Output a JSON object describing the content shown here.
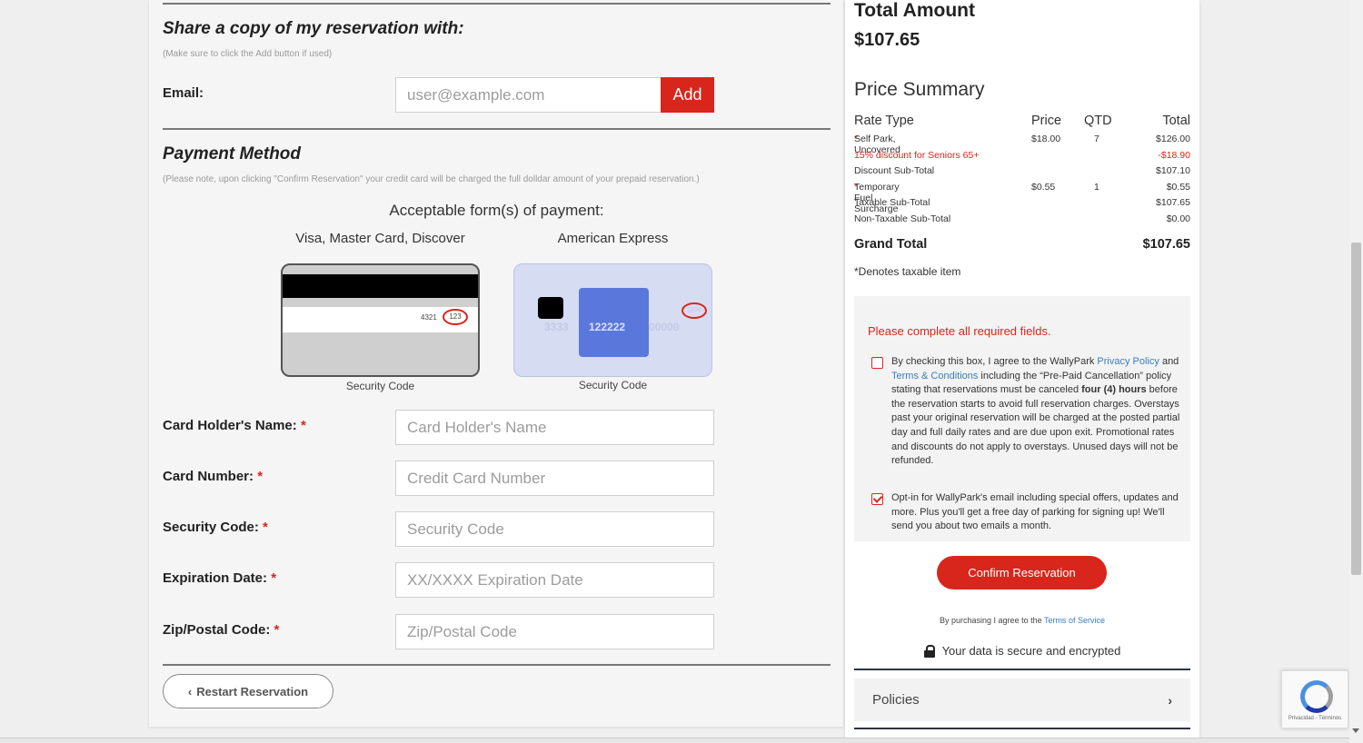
{
  "share": {
    "title": "Share a copy of my reservation with:",
    "note": "(Make sure to click the Add button if used)",
    "email_label": "Email:",
    "email_placeholder": "user@example.com",
    "add_label": "Add"
  },
  "payment": {
    "title": "Payment Method",
    "note": "(Please note, upon clicking \"Confirm Reservation\" your credit card will be charged the full dolldar amount of your prepaid reservation.)",
    "acceptable": "Acceptable form(s) of payment:",
    "card_types_1": "Visa, Master Card, Discover",
    "card_types_2": "American Express",
    "card1_number": "4321",
    "card1_cvv": "123",
    "card2_n1": "3333",
    "card2_n2": "122222",
    "card2_n3": "00000",
    "card2_cvv": "1234",
    "security_code_caption_1": "Security Code",
    "security_code_caption_2": "Security Code",
    "fields": [
      {
        "label": "Card Holder's Name:",
        "placeholder": "Card Holder's Name"
      },
      {
        "label": "Card Number:",
        "placeholder": "Credit Card Number"
      },
      {
        "label": "Security Code:",
        "placeholder": "Security Code"
      },
      {
        "label": "Expiration Date:",
        "placeholder": "XX/XXXX Expiration Date"
      },
      {
        "label": "Zip/Postal Code:",
        "placeholder": "Zip/Postal Code"
      }
    ],
    "required_marker": "*",
    "restart_label": "Restart Reservation",
    "restart_icon": "chevron-left-icon"
  },
  "summary": {
    "total_label": "Total Amount",
    "total_value": "$107.65",
    "title": "Price Summary",
    "headers": {
      "rate": "Rate Type",
      "price": "Price",
      "qty": "QTD",
      "total": "Total"
    },
    "rows": [
      {
        "rate": "Self Park, Uncovered",
        "price": "$18.00",
        "qty": "7",
        "total": "$126.00",
        "taxable": true
      },
      {
        "rate": "15% discount for Seniors 65+",
        "price": "",
        "qty": "",
        "total": "-$18.90",
        "discount": true
      },
      {
        "rate": "Discount Sub-Total",
        "price": "",
        "qty": "",
        "total": "$107.10"
      },
      {
        "rate": "Temporary Fuel Surcharge",
        "price": "$0.55",
        "qty": "1",
        "total": "$0.55",
        "taxable": true
      },
      {
        "rate": "Taxable Sub-Total",
        "price": "",
        "qty": "",
        "total": "$107.65"
      },
      {
        "rate": "Non-Taxable Sub-Total",
        "price": "",
        "qty": "",
        "total": "$0.00"
      }
    ],
    "grand_label": "Grand Total",
    "grand_value": "$107.65",
    "denotes": "*Denotes taxable item"
  },
  "agreement": {
    "required_msg": "Please complete all required fields.",
    "terms_pre": "By checking this box, I agree to the WallyPark ",
    "privacy_link": "Privacy Policy",
    "terms_and": " and ",
    "terms_link": "Terms & Conditions",
    "terms_mid": " including the “Pre-Paid Cancellation” policy stating that reservations must be canceled ",
    "terms_bold": "four (4) hours",
    "terms_post": " before the reservation starts to avoid full reservation charges. Overstays past your original reservation will be charged at the posted partial day and full daily rates and are due upon exit. Promotional rates and discounts do not apply to overstays. Unused days will not be refunded.",
    "terms_checked": false,
    "optin_text": "Opt-in for WallyPark's email including special offers, updates and more. Plus you'll get a free day of parking for signing up! We'll send you about two emails a month.",
    "optin_checked": true,
    "confirm_label": "Confirm Reservation",
    "tos_pre": "By purchasing I agree to the ",
    "tos_link": "Terms of Service",
    "secure_text": "Your data is secure and encrypted",
    "policies_label": "Policies"
  },
  "recaptcha": {
    "footer": "Privacidad - Términos"
  },
  "colors": {
    "accent": "#d8261c",
    "link": "#3a7cc4"
  }
}
